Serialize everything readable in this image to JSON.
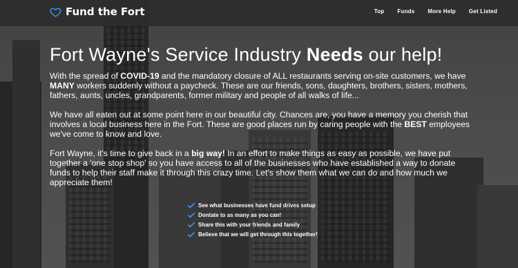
{
  "brand": {
    "name": "Fund the Fort",
    "icon": "heart-icon",
    "icon_color": "#3b8de8"
  },
  "nav": {
    "items": [
      "Top",
      "Funds",
      "More Help",
      "Get Listed"
    ]
  },
  "hero": {
    "title_part1": "Fort Wayne's Service Industry ",
    "title_bold": "Needs",
    "title_part2": " our help!",
    "p1": {
      "t1": "With the spread of ",
      "b1": "COVID-19",
      "t2": " and the mandatory closure of ALL restaurants serving on-site customers, we have ",
      "b2": "MANY",
      "t3": " workers suddenly without a paycheck. These are our friends, sons, daughters, brothers, sisters, mothers, fathers, aunts, uncles, grandparents, former military and people of all walks of life..."
    },
    "p2": {
      "t1": "We have all eaten out at some point here in our beautiful city. Chances are, you have a memory you cherish that involves a local business here in the Fort. These are good places run by caring people with the ",
      "b1": "BEST",
      "t2": " employees we've come to know and love."
    },
    "p3": {
      "t1": "Fort Wayne, it's time to give back in a ",
      "b1": "big way!",
      "t2": " In an effort to make things as easy as possible, we have put together a 'one stop shop' so you have access to all of the businesses who have established a way to donate funds to help their staff make it through this crazy time. Let's show them what we can do and how much we appreciate them!"
    }
  },
  "checklist": {
    "icon": "check-icon",
    "icon_color": "#3b8de8",
    "items": [
      "See what businesses have fund drives setup",
      "Dontate to as many as you can!",
      "Share this with your friends and family",
      "Believe that we will get through this together!"
    ]
  }
}
